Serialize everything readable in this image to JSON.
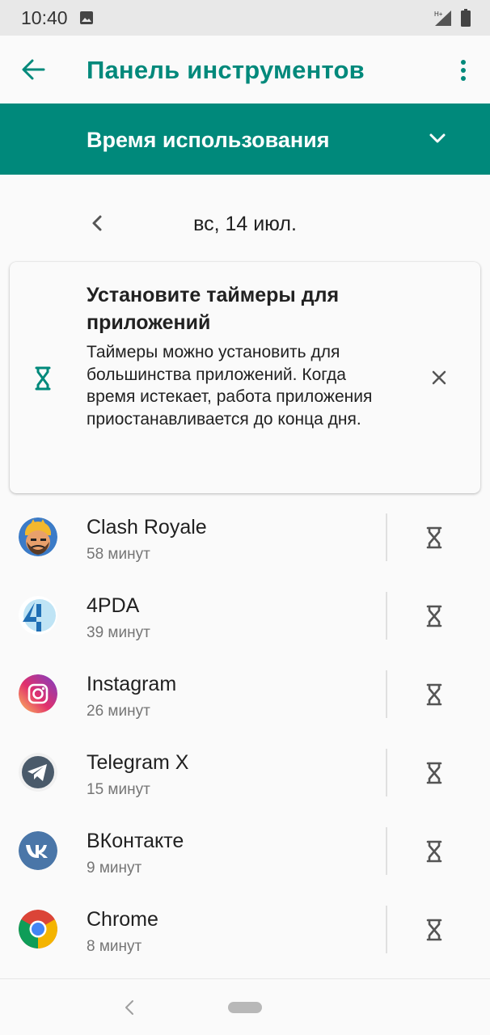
{
  "status_bar": {
    "time": "10:40",
    "icons": [
      "gallery-icon",
      "signal-icon",
      "battery-icon"
    ],
    "network_label": "H+"
  },
  "app_bar": {
    "title": "Панель инструментов",
    "back_icon": "arrow-back-icon",
    "menu_icon": "more-vert-icon"
  },
  "section": {
    "title": "Время использования",
    "icon": "chevron-down-icon"
  },
  "date_nav": {
    "label": "вс, 14 июл.",
    "prev_icon": "chevron-left-icon"
  },
  "timer_card": {
    "title": "Установите таймеры для приложений",
    "body": "Таймеры можно установить для большинства приложений. Когда время истекает, работа приложения приостанавливается до конца дня.",
    "icon": "hourglass-icon",
    "close_icon": "close-icon"
  },
  "apps": [
    {
      "name": "Clash Royale",
      "usage": "58 минут",
      "icon": "clash-royale-icon"
    },
    {
      "name": "4PDA",
      "usage": "39 минут",
      "icon": "4pda-icon"
    },
    {
      "name": "Instagram",
      "usage": "26 минут",
      "icon": "instagram-icon"
    },
    {
      "name": "Telegram X",
      "usage": "15 минут",
      "icon": "telegram-icon"
    },
    {
      "name": "ВКонтакте",
      "usage": "9 минут",
      "icon": "vk-icon"
    },
    {
      "name": "Chrome",
      "usage": "8 минут",
      "icon": "chrome-icon"
    }
  ],
  "colors": {
    "accent": "#00897b",
    "background": "#fafafa",
    "status_bar": "#e8e8e8",
    "secondary_text": "#757575"
  }
}
